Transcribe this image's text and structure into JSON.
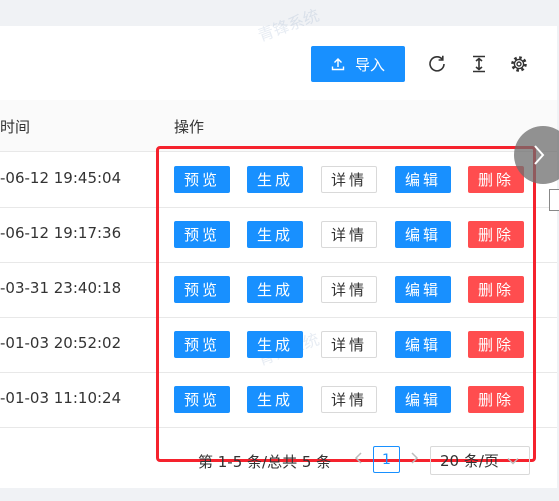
{
  "toolbar": {
    "import_label": "导入",
    "icons": [
      "upload-icon",
      "refresh-icon",
      "column-height-icon",
      "settings-icon"
    ]
  },
  "table": {
    "headers": [
      "时间",
      "操作"
    ],
    "rows": [
      {
        "time": "-06-12 19:45:04"
      },
      {
        "time": "-06-12 19:17:36"
      },
      {
        "time": "-03-31 23:40:18"
      },
      {
        "time": "-01-03 20:52:02"
      },
      {
        "time": "-01-03 11:10:24"
      }
    ],
    "actions": {
      "preview": "预览",
      "generate": "生成",
      "detail": "详情",
      "edit": "编辑",
      "delete": "删除"
    }
  },
  "pagination": {
    "total": "第 1-5 条/总共 5 条",
    "current_page": "1",
    "page_size": "20 条/页"
  },
  "watermark": "青锋系统",
  "colors": {
    "primary": "#1890ff",
    "danger": "#ff4d4f",
    "highlight": "#f5222d"
  }
}
